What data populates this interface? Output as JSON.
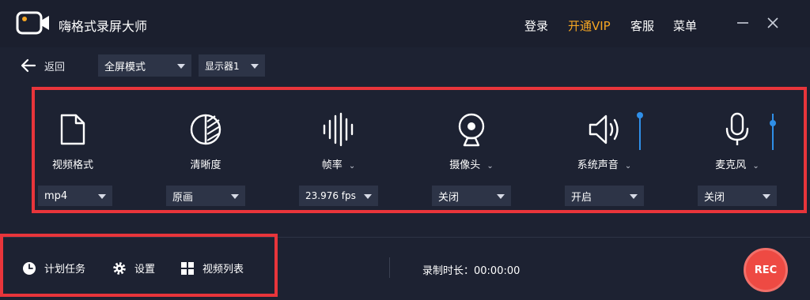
{
  "app": {
    "title": "嗨格式录屏大师"
  },
  "header": {
    "login": "登录",
    "vip": "开通VIP",
    "support": "客服",
    "menu": "菜单"
  },
  "toolbar": {
    "back": "返回",
    "mode": "全屏模式",
    "display": "显示器1"
  },
  "tools": [
    {
      "label": "视频格式",
      "value": "mp4",
      "icon": "file-icon"
    },
    {
      "label": "清晰度",
      "value": "原画",
      "icon": "quality-icon"
    },
    {
      "label": "帧率",
      "value": "23.976 fps",
      "icon": "waveform-icon"
    },
    {
      "label": "摄像头",
      "value": "关闭",
      "icon": "webcam-icon"
    },
    {
      "label": "系统声音",
      "value": "开启",
      "icon": "speaker-icon"
    },
    {
      "label": "麦克风",
      "value": "关闭",
      "icon": "microphone-icon"
    }
  ],
  "bottom": {
    "schedule": "计划任务",
    "settings": "设置",
    "video_list": "视频列表",
    "duration_label": "录制时长：00:00:00",
    "rec": "REC"
  },
  "colors": {
    "background": "#1d2232",
    "accent_vip": "#f5a623",
    "rec_button": "#ee4a43",
    "highlight": "#e8353b",
    "slider": "#2f8fe8"
  }
}
